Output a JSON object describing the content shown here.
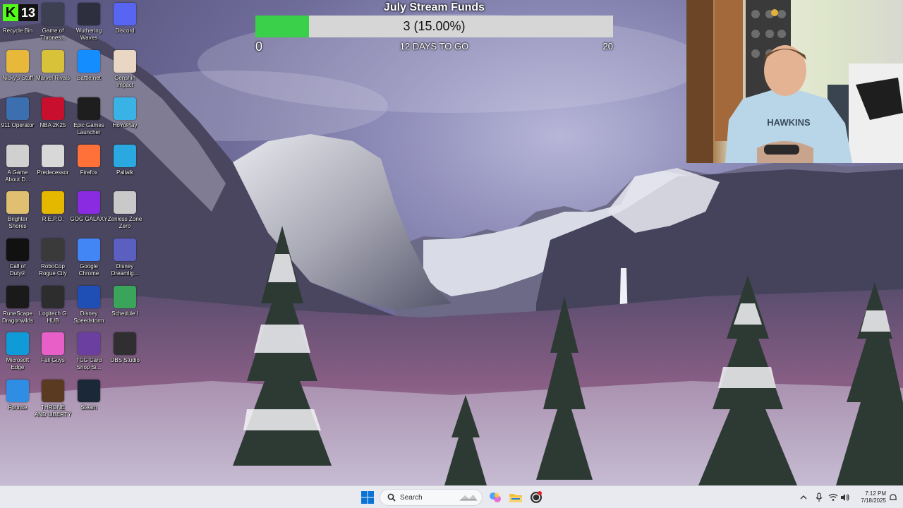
{
  "stream_goal": {
    "title": "July Stream Funds",
    "progress_text": "3 (15.00%)",
    "progress_fraction": 0.15,
    "min_label": "0",
    "max_label": "20",
    "days_label": "12 DAYS TO GO",
    "fill_color": "#3bd04a",
    "track_color": "#d6d6d6"
  },
  "kick_badge": {
    "letter": "K",
    "count": "13",
    "color": "#53fc18"
  },
  "webcam": {
    "shirt_text": "HAWKINS"
  },
  "desktop_icons": [
    {
      "label": "Recycle Bin",
      "icon": "recycle-bin-icon",
      "color": "#9aa4b3"
    },
    {
      "label": "Game of\nThrones...",
      "icon": "game-of-thrones-icon",
      "color": "#3c4050"
    },
    {
      "label": "Wuthering\nWaves",
      "icon": "wuthering-waves-icon",
      "color": "#2d2f3e"
    },
    {
      "label": "Discord",
      "icon": "discord-icon",
      "color": "#5865f2"
    },
    {
      "label": "Nicky's Stuff",
      "icon": "folder-icon",
      "color": "#e8b83a"
    },
    {
      "label": "Marvel Rivals",
      "icon": "marvel-rivals-icon",
      "color": "#d7c23a"
    },
    {
      "label": "Battle.net",
      "icon": "battle-net-icon",
      "color": "#148eff"
    },
    {
      "label": "Genshin\nImpact",
      "icon": "genshin-impact-icon",
      "color": "#e9d7c3"
    },
    {
      "label": "911 Operator",
      "icon": "911-operator-icon",
      "color": "#3b6fb0"
    },
    {
      "label": "NBA 2K25",
      "icon": "nba-2k25-icon",
      "color": "#c8102e"
    },
    {
      "label": "Epic Games\nLauncher",
      "icon": "epic-games-icon",
      "color": "#1e1e1e"
    },
    {
      "label": "HoYoPlay",
      "icon": "hoyoplay-icon",
      "color": "#39b3e6"
    },
    {
      "label": "A Game\nAbout D...",
      "icon": "game-about-icon",
      "color": "#d0d0d0"
    },
    {
      "label": "Predecessor",
      "icon": "predecessor-icon",
      "color": "#d8d8d8"
    },
    {
      "label": "Firefox",
      "icon": "firefox-icon",
      "color": "#ff7139"
    },
    {
      "label": "Paltalk",
      "icon": "paltalk-icon",
      "color": "#2aa9e0"
    },
    {
      "label": "Brighter\nShores",
      "icon": "brighter-shores-icon",
      "color": "#e0c070"
    },
    {
      "label": "R.E.P.O.",
      "icon": "repo-icon",
      "color": "#e5b800"
    },
    {
      "label": "GOG GALAXY",
      "icon": "gog-galaxy-icon",
      "color": "#8a2be2"
    },
    {
      "label": "Zenless Zone\nZero",
      "icon": "zenless-zone-zero-icon",
      "color": "#c9c9c9"
    },
    {
      "label": "Call of\nDuty®",
      "icon": "call-of-duty-icon",
      "color": "#111111"
    },
    {
      "label": "RoboCop\nRogue City",
      "icon": "robocop-icon",
      "color": "#3a3a3a"
    },
    {
      "label": "Google\nChrome",
      "icon": "chrome-icon",
      "color": "#4285f4"
    },
    {
      "label": "Disney\nDreamlig...",
      "icon": "disney-dreamlight-icon",
      "color": "#5a5fc0"
    },
    {
      "label": "RuneScape\nDragonwilds",
      "icon": "runescape-icon",
      "color": "#1a1a1a"
    },
    {
      "label": "Logitech G\nHUB",
      "icon": "logitech-ghub-icon",
      "color": "#2d2d2d"
    },
    {
      "label": "Disney\nSpeedstorm",
      "icon": "disney-speedstorm-icon",
      "color": "#1f4fb5"
    },
    {
      "label": "Schedule I",
      "icon": "schedule-i-icon",
      "color": "#3aa55a"
    },
    {
      "label": "Microsoft\nEdge",
      "icon": "edge-icon",
      "color": "#0f9bd7"
    },
    {
      "label": "Fall Guys",
      "icon": "fall-guys-icon",
      "color": "#e85fc8"
    },
    {
      "label": "TCG Card\nShop Si...",
      "icon": "tcg-card-shop-icon",
      "color": "#6b3fa0"
    },
    {
      "label": "OBS Studio",
      "icon": "obs-studio-icon",
      "color": "#302e31"
    },
    {
      "label": "Fortnite",
      "icon": "fortnite-icon",
      "color": "#2f8de4"
    },
    {
      "label": "THRONE\nAND LIBERTY",
      "icon": "throne-and-liberty-icon",
      "color": "#5a3b22"
    },
    {
      "label": "Steam",
      "icon": "steam-icon",
      "color": "#1b2838"
    }
  ],
  "taskbar": {
    "search_placeholder": "Search",
    "apps": [
      {
        "name": "copilot-icon",
        "color": "#7b5cff"
      },
      {
        "name": "file-explorer-icon",
        "color": "#f3c03a"
      },
      {
        "name": "obs-taskbar-icon",
        "color": "#302e31"
      }
    ],
    "time": "7:12 PM",
    "date": "7/18/2025"
  }
}
